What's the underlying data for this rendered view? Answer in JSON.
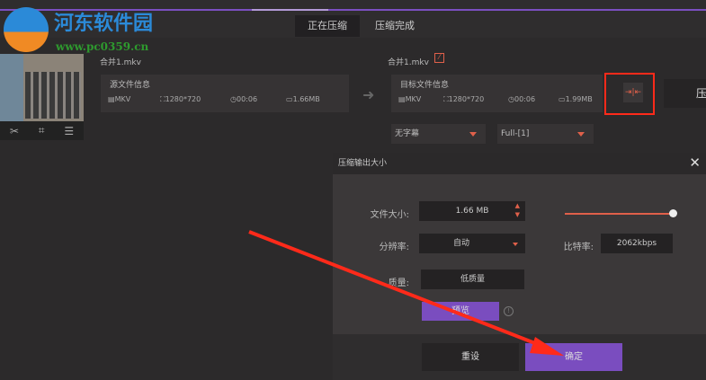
{
  "tabs": [
    {
      "label": "正在压缩"
    },
    {
      "label": "压缩完成"
    }
  ],
  "watermark": {
    "name": "河东软件园",
    "url": "www.pc0359.cn"
  },
  "source": {
    "filename": "合并1.mkv",
    "title": "源文件信息",
    "format": "MKV",
    "resolution": "1280*720",
    "duration": "00:06",
    "size": "1.66MB"
  },
  "target": {
    "filename": "合并1.mkv",
    "title": "目标文件信息",
    "format": "MKV",
    "resolution": "1280*720",
    "duration": "00:06",
    "size": "1.99MB"
  },
  "subtitle_select": "无字幕",
  "audio_select": "Full-[1]",
  "compress_button": "压",
  "dialog": {
    "title": "压缩输出大小",
    "file_size_label": "文件大小:",
    "file_size": "1.66 MB",
    "resolution_label": "分辨率:",
    "resolution": "自动",
    "bitrate_label": "比特率:",
    "bitrate": "2062kbps",
    "quality_label": "质量:",
    "quality": "低质量",
    "preview": "预览",
    "reset": "重设",
    "confirm": "确定",
    "slider_value": 1.0
  },
  "colors": {
    "accent": "#7b4fc0",
    "highlight": "#e0604a",
    "annotation": "#ff2a1a"
  }
}
